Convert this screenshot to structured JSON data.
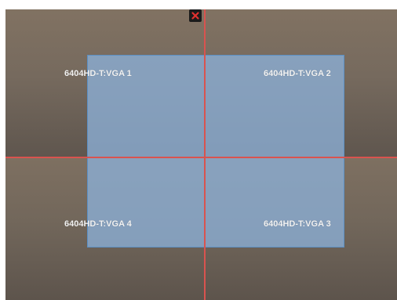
{
  "video_wall": {
    "screens": [
      {
        "id": 1,
        "label": "6404HD-T:VGA 1"
      },
      {
        "id": 2,
        "label": "6404HD-T:VGA 2"
      },
      {
        "id": 4,
        "label": "6404HD-T:VGA 4"
      },
      {
        "id": 3,
        "label": "6404HD-T:VGA 3"
      }
    ],
    "close_icon": "close-icon",
    "colors": {
      "divider": "#d9534f",
      "window_fill": "#8cafd7",
      "window_border": "#5b8fc4",
      "close_mark": "#e0312f",
      "label": "#f2f2f2"
    }
  }
}
